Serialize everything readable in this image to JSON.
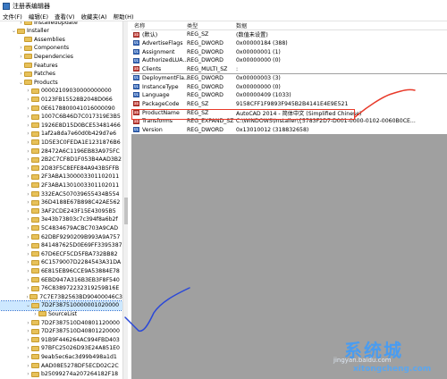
{
  "window": {
    "title": "注册表编辑器"
  },
  "menu": [
    "文件(F)",
    "编辑(E)",
    "查看(V)",
    "收藏夹(A)",
    "帮助(H)"
  ],
  "tree": [
    {
      "label": "InstalledUpdate",
      "indent": 2,
      "exp": ">"
    },
    {
      "label": "Installer",
      "indent": 1,
      "exp": "v"
    },
    {
      "label": "Assemblies",
      "indent": 2,
      "exp": ""
    },
    {
      "label": "Components",
      "indent": 2,
      "exp": ">"
    },
    {
      "label": "Dependencies",
      "indent": 2,
      "exp": ">"
    },
    {
      "label": "Features",
      "indent": 2,
      "exp": ""
    },
    {
      "label": "Patches",
      "indent": 2,
      "exp": ">"
    },
    {
      "label": "Products",
      "indent": 2,
      "exp": "v"
    },
    {
      "label": "00002109030000000000",
      "indent": 3,
      "exp": ">"
    },
    {
      "label": "0123FB15528B2048D066",
      "indent": 3,
      "exp": ">"
    },
    {
      "label": "0E6178800041016000090",
      "indent": 3,
      "exp": ">"
    },
    {
      "label": "1007C6B46D7C017319E3B5",
      "indent": 3,
      "exp": ">"
    },
    {
      "label": "1926E8D15D0BCE53481466",
      "indent": 3,
      "exp": ">"
    },
    {
      "label": "1af2a8da7e60d0b429d7e6",
      "indent": 3,
      "exp": ">"
    },
    {
      "label": "1D5E3C0FEDA1E1231876B6",
      "indent": 3,
      "exp": ">"
    },
    {
      "label": "28472A6C1196EB83A975FC",
      "indent": 3,
      "exp": ">"
    },
    {
      "label": "2B2C7CF8D1F053B4AAD3B2",
      "indent": 3,
      "exp": ">"
    },
    {
      "label": "2D83F5C8EFE84A943B5FFB",
      "indent": 3,
      "exp": ">"
    },
    {
      "label": "2F3ABA1300003301102011",
      "indent": 3,
      "exp": ">"
    },
    {
      "label": "2F3ABA1301003301102011",
      "indent": 3,
      "exp": ">"
    },
    {
      "label": "332EAC507039655434B554",
      "indent": 3,
      "exp": ">"
    },
    {
      "label": "36D4188E67B898C42AE562",
      "indent": 3,
      "exp": ">"
    },
    {
      "label": "3AF2CDE243F15E43095B5",
      "indent": 3,
      "exp": ">"
    },
    {
      "label": "3e43b73803c7c394f8a6b2f",
      "indent": 3,
      "exp": ">"
    },
    {
      "label": "5C4834679ACBC703A9CAD",
      "indent": 3,
      "exp": ">"
    },
    {
      "label": "62DBF9290209B993A9A757",
      "indent": 3,
      "exp": ">"
    },
    {
      "label": "841487625D0E69FF3395387",
      "indent": 3,
      "exp": ">"
    },
    {
      "label": "67D6ECF5CD5FBA732BB82",
      "indent": 3,
      "exp": ">"
    },
    {
      "label": "6C1579007D2284543A31DA",
      "indent": 3,
      "exp": ">"
    },
    {
      "label": "6E815EB96CCE9A53884E78",
      "indent": 3,
      "exp": ">"
    },
    {
      "label": "6EBD947A316B3EB3F8F540",
      "indent": 3,
      "exp": ">"
    },
    {
      "label": "76C838972232319259B16E",
      "indent": 3,
      "exp": ">"
    },
    {
      "label": "7C7E73B2563BD90400046C3",
      "indent": 3,
      "exp": ">"
    },
    {
      "label": "7D2F387510000001020000",
      "indent": 3,
      "exp": "v",
      "selected": true
    },
    {
      "label": "SourceList",
      "indent": 4,
      "exp": ">"
    },
    {
      "label": "7D2F387510D40801120000",
      "indent": 3,
      "exp": ">"
    },
    {
      "label": "7D2F387510D40801220000",
      "indent": 3,
      "exp": ">"
    },
    {
      "label": "91B9F446264AC994FBD403",
      "indent": 3,
      "exp": ">"
    },
    {
      "label": "97BFC25026D93E24A851E0",
      "indent": 3,
      "exp": ">"
    },
    {
      "label": "9eab5ec6ac3d99b498a1d1",
      "indent": 3,
      "exp": ">"
    },
    {
      "label": "AAD08E5278DF5ECD02C2C",
      "indent": 3,
      "exp": ">"
    },
    {
      "label": "b25099274a207264182F18",
      "indent": 3,
      "exp": ">"
    }
  ],
  "columns": {
    "name": "名称",
    "type": "类型",
    "data": "数据"
  },
  "values": [
    {
      "name": "(默认)",
      "type": "REG_SZ",
      "data": "(数值未设置)",
      "kind": "sz"
    },
    {
      "name": "AdvertiseFlags",
      "type": "REG_DWORD",
      "data": "0x00000184 (388)",
      "kind": "dw"
    },
    {
      "name": "Assignment",
      "type": "REG_DWORD",
      "data": "0x00000001 (1)",
      "kind": "dw"
    },
    {
      "name": "AuthorizedLUA...",
      "type": "REG_DWORD",
      "data": "0x00000000 (0)",
      "kind": "dw"
    },
    {
      "name": "Clients",
      "type": "REG_MULTI_SZ",
      "data": ":",
      "kind": "sz"
    },
    {
      "name": "DeploymentFla...",
      "type": "REG_DWORD",
      "data": "0x00000003 (3)",
      "kind": "dw"
    },
    {
      "name": "InstanceType",
      "type": "REG_DWORD",
      "data": "0x00000000 (0)",
      "kind": "dw"
    },
    {
      "name": "Language",
      "type": "REG_DWORD",
      "data": "0x00000409 (1033)",
      "kind": "dw"
    },
    {
      "name": "PackageCode",
      "type": "REG_SZ",
      "data": "9158CFF1F9893F945B2B4141E4E9E521",
      "kind": "sz"
    },
    {
      "name": "ProductName",
      "type": "REG_SZ",
      "data": "AutoCAD 2014 - 简体中文 (Simplified Chinese)",
      "kind": "sz"
    },
    {
      "name": "Transforms",
      "type": "REG_EXPAND_SZ",
      "data": "C:\\WINDOWS\\Installer\\{5783F2D7-D001-0000-0102-0060B0CE...",
      "kind": "sz"
    },
    {
      "name": "Version",
      "type": "REG_DWORD",
      "data": "0x13010012 (318832658)",
      "kind": "dw"
    }
  ],
  "watermark": {
    "brand": "系统城",
    "url1": "jingyan.baidu.com",
    "url2": "xitongcheng.com"
  },
  "colors": {
    "highlight": "#e83a2a",
    "selection": "#cde8ff",
    "annotation_blue": "#2a48d8"
  }
}
